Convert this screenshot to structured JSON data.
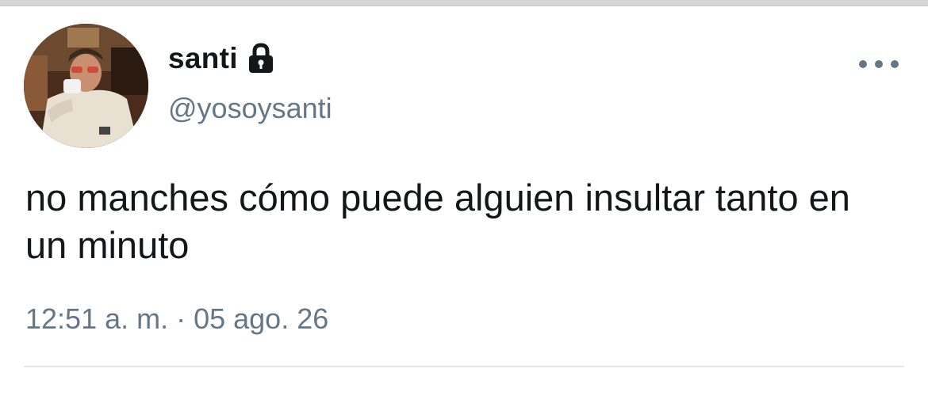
{
  "tweet": {
    "display_name": "santi",
    "handle": "@yosoysanti",
    "protected_icon": "lock-icon",
    "text": "no manches cómo puede alguien insultar tanto en un minuto",
    "timestamp": "12:51 a. m. · 05 ago. 26",
    "more_icon": "more-options-icon"
  },
  "colors": {
    "text_primary": "#14171a",
    "text_secondary": "#657786",
    "divider": "#e1e8ed"
  }
}
